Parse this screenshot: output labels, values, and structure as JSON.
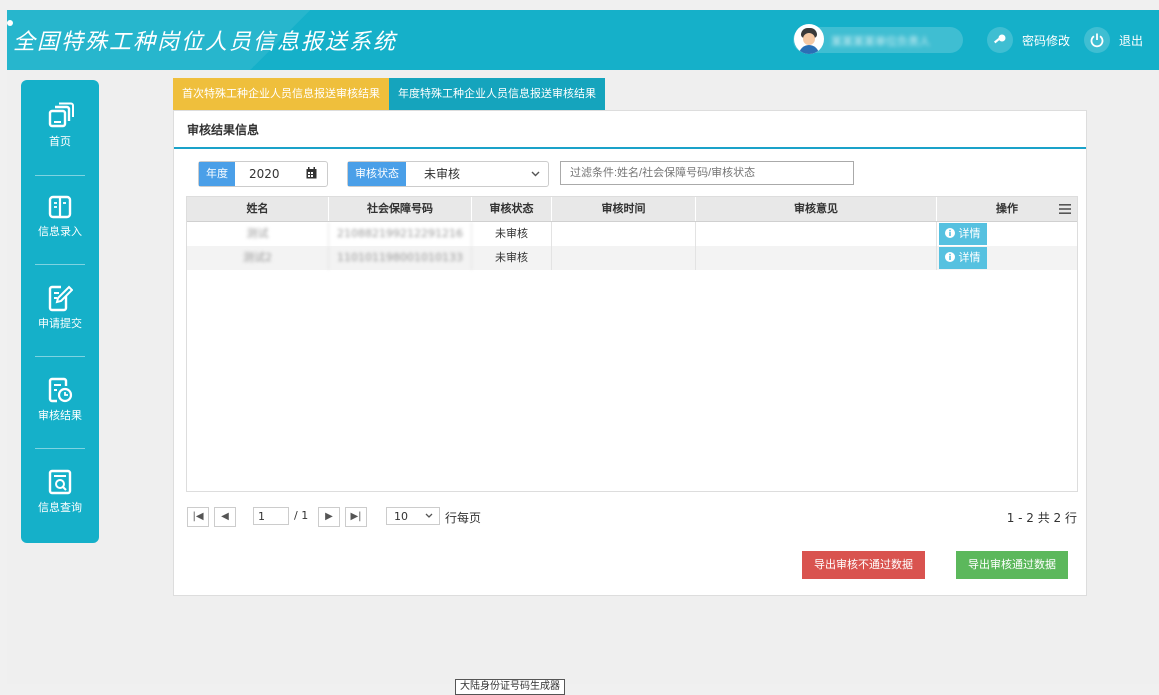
{
  "header": {
    "app_title": "全国特殊工种岗位人员信息报送系统",
    "user_name": "某某某某单位负责人",
    "change_password": "密码修改",
    "logout": "退出"
  },
  "sidebar": {
    "items": [
      {
        "label": "首页",
        "icon": "home-icon"
      },
      {
        "label": "信息录入",
        "icon": "book-icon"
      },
      {
        "label": "申请提交",
        "icon": "edit-icon"
      },
      {
        "label": "审核结果",
        "icon": "clock-doc-icon"
      },
      {
        "label": "信息查询",
        "icon": "search-doc-icon"
      }
    ]
  },
  "tabs": [
    {
      "label": "首次特殊工种企业人员信息报送审核结果",
      "color": "#efbf3c"
    },
    {
      "label": "年度特殊工种企业人员信息报送审核结果",
      "color": "#15a4bd"
    }
  ],
  "panel": {
    "title": "审核结果信息"
  },
  "filters": {
    "year_label": "年度",
    "year_value": "2020",
    "status_label": "审核状态",
    "status_value": "未审核",
    "search_placeholder": "过滤条件:姓名/社会保障号码/审核状态"
  },
  "table": {
    "columns": [
      "姓名",
      "社会保障号码",
      "审核状态",
      "审核时间",
      "审核意见",
      "操作"
    ],
    "rows": [
      {
        "name": "测试",
        "ssn": "210882199212291216",
        "status": "未审核",
        "time": "",
        "opinion": "",
        "action": "详情"
      },
      {
        "name": "测试2",
        "ssn": "110101198001010133",
        "status": "未审核",
        "time": "",
        "opinion": "",
        "action": "详情"
      }
    ]
  },
  "pager": {
    "page": "1",
    "of_text": "/ 1",
    "page_size": "10",
    "per_page": "行每页",
    "range": "1 - 2 共 2 行"
  },
  "actions": {
    "export_fail": "导出审核不通过数据",
    "export_pass": "导出审核通过数据"
  },
  "footer": {
    "tag": "大陆身份证号码生成器"
  },
  "colors": {
    "brand": "#15b0c9",
    "tab_active": "#efbf3c",
    "label_blue": "#4a9fe8",
    "danger": "#d9534f",
    "success": "#5cb85c"
  }
}
